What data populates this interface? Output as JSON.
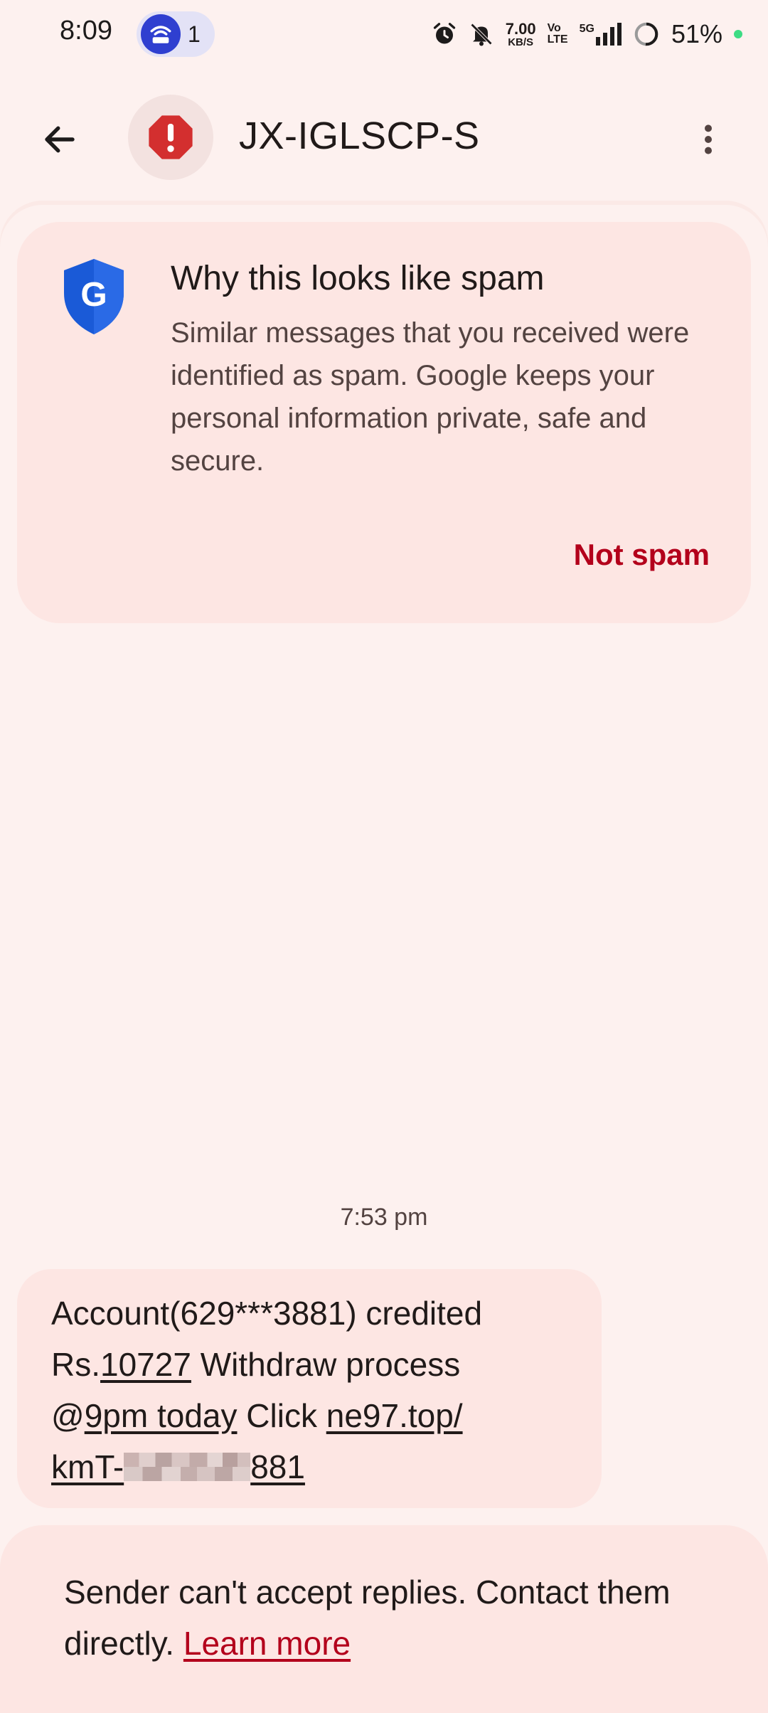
{
  "status_bar": {
    "time": "8:09",
    "notification_count": "1",
    "net_speed_value": "7.00",
    "net_speed_unit": "KB/S",
    "volte_top": "Vo",
    "volte_bottom": "LTE",
    "network_type": "5G",
    "battery": "51%",
    "icons": [
      "hotspot-icon",
      "alarm-icon",
      "muted-bell-icon",
      "signal-icon",
      "battery-icon"
    ]
  },
  "app_bar": {
    "contact_name": "JX-IGLSCP-S",
    "icons": [
      "back-arrow-icon",
      "spam-warning-icon",
      "more-vert-icon"
    ]
  },
  "spam_card": {
    "title": "Why this looks like spam",
    "body": "Similar messages that you received were identified as spam. Google keeps your personal information private, safe and secure.",
    "action": "Not spam",
    "icon": "google-shield-icon"
  },
  "message": {
    "time": "7:53 pm",
    "line1": "Account(629***3881) credited",
    "line2_prefix": "Rs.",
    "line2_amount": "10727",
    "line2_suffix": " Withdraw process",
    "line3_prefix": "@",
    "line3_time": "9pm today",
    "line3_mid": " Click ",
    "line3_link": "ne97.top/",
    "line4_prefix": "kmT-",
    "line4_suffix": "881"
  },
  "notice": {
    "text": "Sender can't accept replies. Contact them directly. ",
    "link": "Learn more"
  },
  "colors": {
    "background": "#fdf1ef",
    "card": "#fde6e3",
    "accent_red": "#b3001b",
    "shield_blue": "#1a5ad7"
  }
}
